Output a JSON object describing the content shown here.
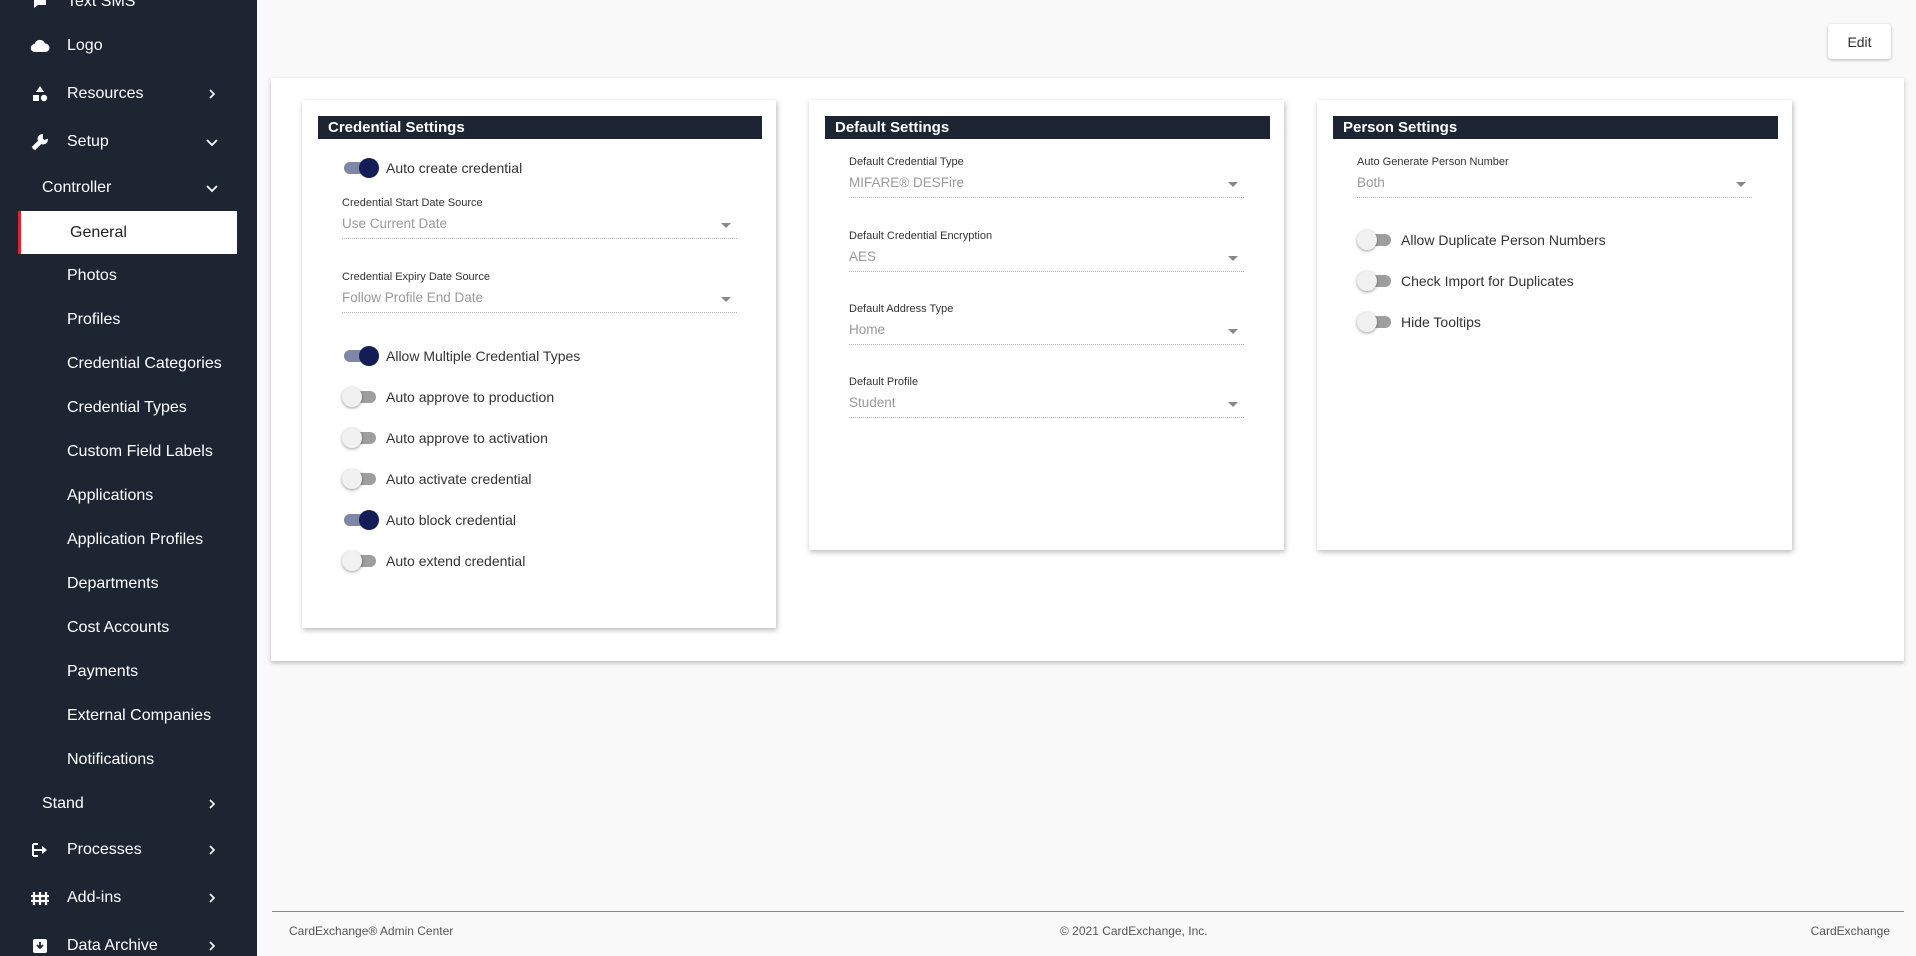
{
  "sidebar": {
    "items": [
      {
        "label": "Text SMS",
        "icon": "chat-icon"
      },
      {
        "label": "Logo",
        "icon": "cloud-icon"
      },
      {
        "label": "Resources",
        "icon": "shapes-icon"
      },
      {
        "label": "Setup",
        "icon": "tools-icon"
      },
      {
        "label": "Controller"
      },
      {
        "label": "General"
      },
      {
        "label": "Photos"
      },
      {
        "label": "Profiles"
      },
      {
        "label": "Credential Categories"
      },
      {
        "label": "Credential Types"
      },
      {
        "label": "Custom Field Labels"
      },
      {
        "label": "Applications"
      },
      {
        "label": "Application Profiles"
      },
      {
        "label": "Departments"
      },
      {
        "label": "Cost Accounts"
      },
      {
        "label": "Payments"
      },
      {
        "label": "External Companies"
      },
      {
        "label": "Notifications"
      },
      {
        "label": "Stand"
      },
      {
        "label": "Processes",
        "icon": "processes-icon"
      },
      {
        "label": "Add-ins",
        "icon": "add-ins-icon"
      },
      {
        "label": "Data Archive",
        "icon": "archive-icon"
      }
    ],
    "active_item": "General",
    "accent_color": "#e0202a"
  },
  "toolbar": {
    "edit_label": "Edit"
  },
  "credential_settings": {
    "title": "Credential Settings",
    "auto_create": {
      "label": "Auto create credential",
      "on": true
    },
    "start_date": {
      "label": "Credential Start Date Source",
      "value": "Use Current Date"
    },
    "expiry_date": {
      "label": "Credential Expiry Date Source",
      "value": "Follow Profile End Date"
    },
    "allow_multiple": {
      "label": "Allow Multiple Credential Types",
      "on": true
    },
    "approve_production": {
      "label": "Auto approve to production",
      "on": false
    },
    "approve_activation": {
      "label": "Auto approve to activation",
      "on": false
    },
    "auto_activate": {
      "label": "Auto activate credential",
      "on": false
    },
    "auto_block": {
      "label": "Auto block credential",
      "on": true
    },
    "auto_extend": {
      "label": "Auto extend credential",
      "on": false
    }
  },
  "default_settings": {
    "title": "Default Settings",
    "credential_type": {
      "label": "Default Credential Type",
      "value": "MIFARE® DESFire"
    },
    "encryption": {
      "label": "Default Credential Encryption",
      "value": "AES"
    },
    "address_type": {
      "label": "Default Address Type",
      "value": "Home"
    },
    "profile": {
      "label": "Default Profile",
      "value": "Student"
    }
  },
  "person_settings": {
    "title": "Person Settings",
    "auto_generate": {
      "label": "Auto Generate Person Number",
      "value": "Both"
    },
    "allow_duplicates": {
      "label": "Allow Duplicate Person Numbers",
      "on": false
    },
    "check_import": {
      "label": "Check Import for Duplicates",
      "on": false
    },
    "hide_tooltips": {
      "label": "Hide Tooltips",
      "on": false
    }
  },
  "footer": {
    "left": "CardExchange® Admin Center",
    "center": "© 2021 CardExchange, Inc.",
    "right": "CardExchange"
  },
  "colors": {
    "sidebar_bg": "#1e2532",
    "header_bg": "#1e2532",
    "toggle_on": "#141d55"
  }
}
